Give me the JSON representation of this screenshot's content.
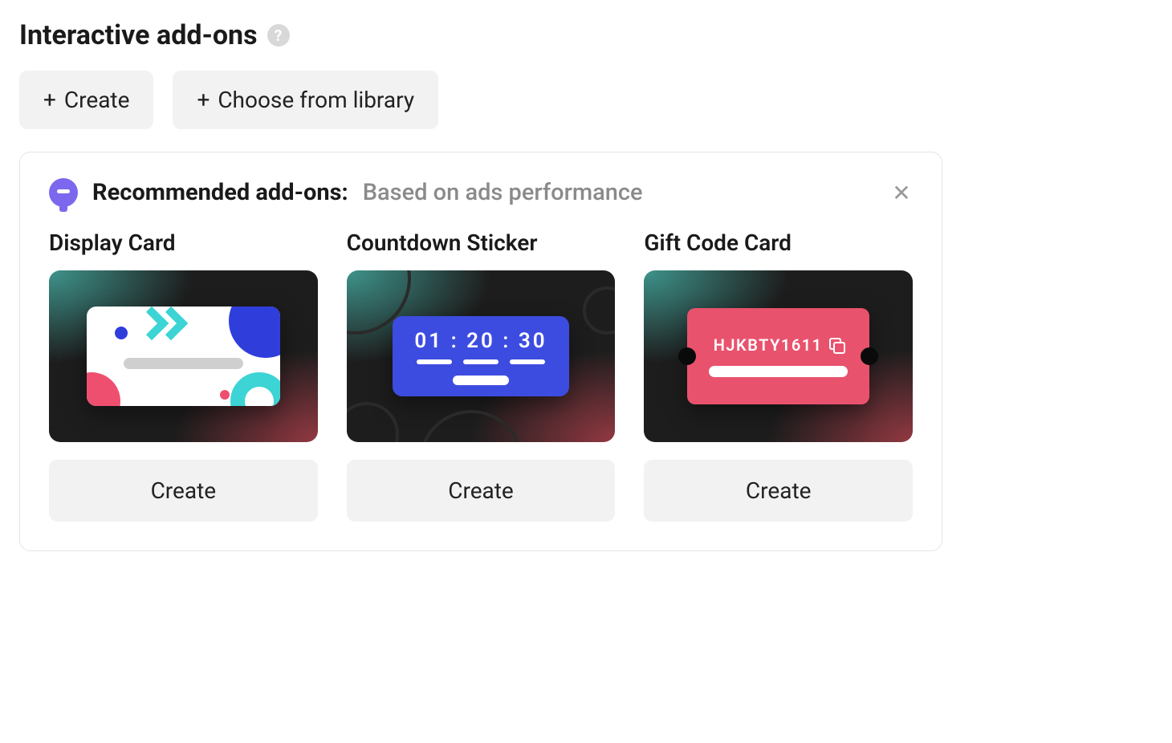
{
  "section": {
    "title": "Interactive add-ons"
  },
  "actions": {
    "create_label": "Create",
    "library_label": "Choose from library"
  },
  "panel": {
    "rec_label": "Recommended add-ons:",
    "rec_sub": "Based on ads performance",
    "cards": [
      {
        "title": "Display Card",
        "create_label": "Create"
      },
      {
        "title": "Countdown Sticker",
        "create_label": "Create",
        "countdown_text": "01 : 20 : 30"
      },
      {
        "title": "Gift Code Card",
        "create_label": "Create",
        "gift_code": "HJKBTY1611"
      }
    ]
  }
}
